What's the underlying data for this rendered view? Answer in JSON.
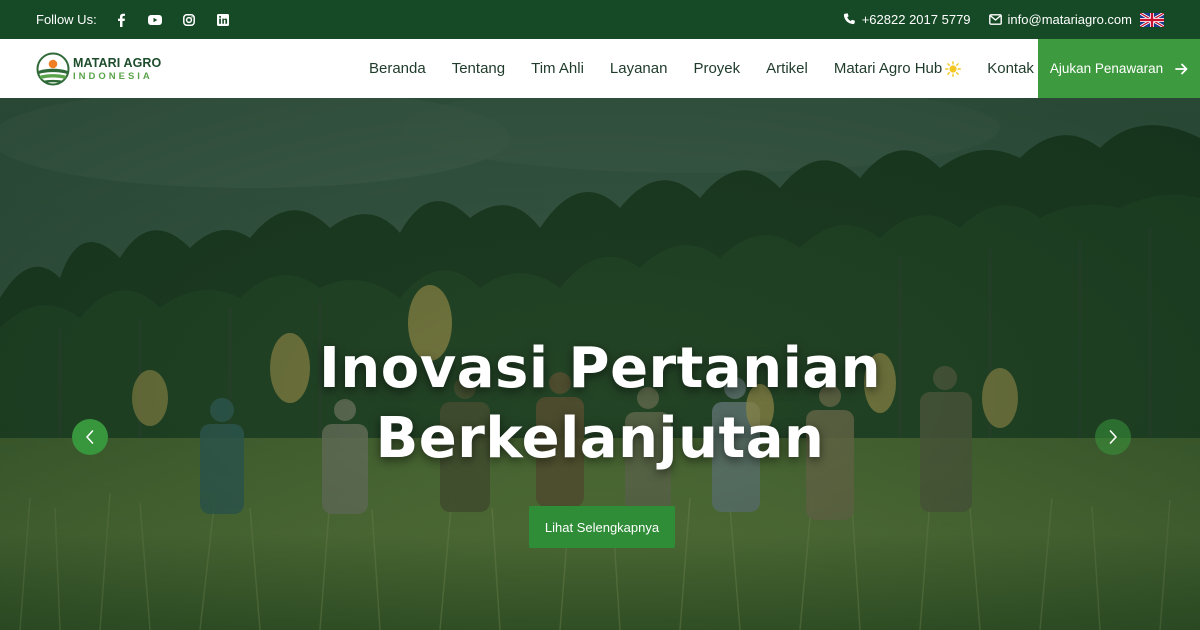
{
  "topbar": {
    "follow_label": "Follow Us:",
    "social_icons": [
      "facebook-icon",
      "youtube-icon",
      "instagram-icon",
      "linkedin-icon"
    ],
    "phone": "+62822 2017 5779",
    "email": "info@matariagro.com",
    "language": "English (UK flag)"
  },
  "brand": {
    "name_line1": "MATARI AGRO",
    "name_line2": "INDONESIA"
  },
  "nav": {
    "items": [
      "Beranda",
      "Tentang",
      "Tim Ahli",
      "Layanan",
      "Proyek",
      "Artikel",
      "Matari Agro Hub",
      "Kontak"
    ],
    "cta_label": "Ajukan Penawaran"
  },
  "hero": {
    "title_line1": "Inovasi Pertanian",
    "title_line2": "Berkelanjutan",
    "button_label": "Lihat Selengkapnya"
  },
  "colors": {
    "topbar_bg": "#164a26",
    "cta_green": "#3d9a3e",
    "hero_button": "#2f8c37",
    "nav_text": "#1f3b2a"
  }
}
